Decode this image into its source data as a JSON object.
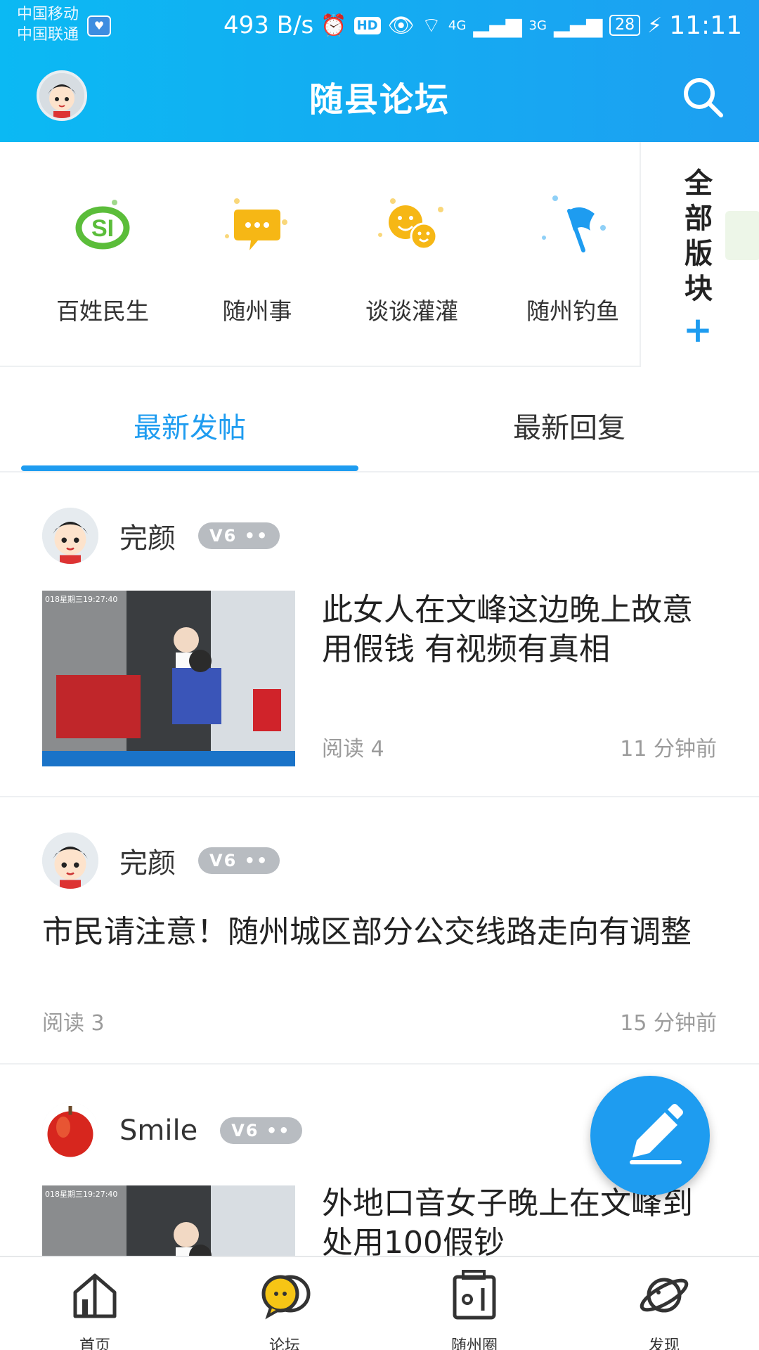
{
  "status_bar": {
    "carrier1": "中国移动",
    "carrier2": "中国联通",
    "net_speed": "493 B/s",
    "hd": "HD",
    "signal1": "4G",
    "signal2": "3G",
    "battery": "28",
    "time": "11:11"
  },
  "header": {
    "title": "随县论坛"
  },
  "categories": [
    {
      "label": "百姓民生",
      "icon": "social-security-icon",
      "color": "#5bbd3a"
    },
    {
      "label": "随州事",
      "icon": "chat-bubble-icon",
      "color": "#f6b715"
    },
    {
      "label": "谈谈灌灌",
      "icon": "smiley-faces-icon",
      "color": "#f6b715"
    },
    {
      "label": "随州钓鱼",
      "icon": "flag-icon",
      "color": "#1e9cf0"
    }
  ],
  "all_blocks": {
    "text": "全部版块",
    "plus": "+"
  },
  "tabs": {
    "latest_posts": "最新发帖",
    "latest_replies": "最新回复"
  },
  "posts": [
    {
      "author": "完颜",
      "level": "V6 ••",
      "title": "此女人在文峰这边晚上故意用假钱 有视频有真相",
      "reads": "阅读 4",
      "time": "11 分钟前",
      "thumb_caption": "018星期三19:27:40"
    },
    {
      "author": "完颜",
      "level": "V6 ••",
      "title": "市民请注意！随州城区部分公交线路走向有调整",
      "reads": "阅读 3",
      "time": "15 分钟前"
    },
    {
      "author": "Smile",
      "level": "V6 ••",
      "title": "外地口音女子晚上在文峰到处用100假钞",
      "thumb_caption": "018星期三19:27:40"
    }
  ],
  "bottom_nav": [
    {
      "label": "首页",
      "icon": "home-icon"
    },
    {
      "label": "论坛",
      "icon": "forum-icon"
    },
    {
      "label": "随州圈",
      "icon": "circle-icon"
    },
    {
      "label": "发现",
      "icon": "planet-icon"
    }
  ],
  "colors": {
    "accent": "#1e9cf0",
    "header_start": "#0bb9f3",
    "header_end": "#1d9ff1"
  }
}
